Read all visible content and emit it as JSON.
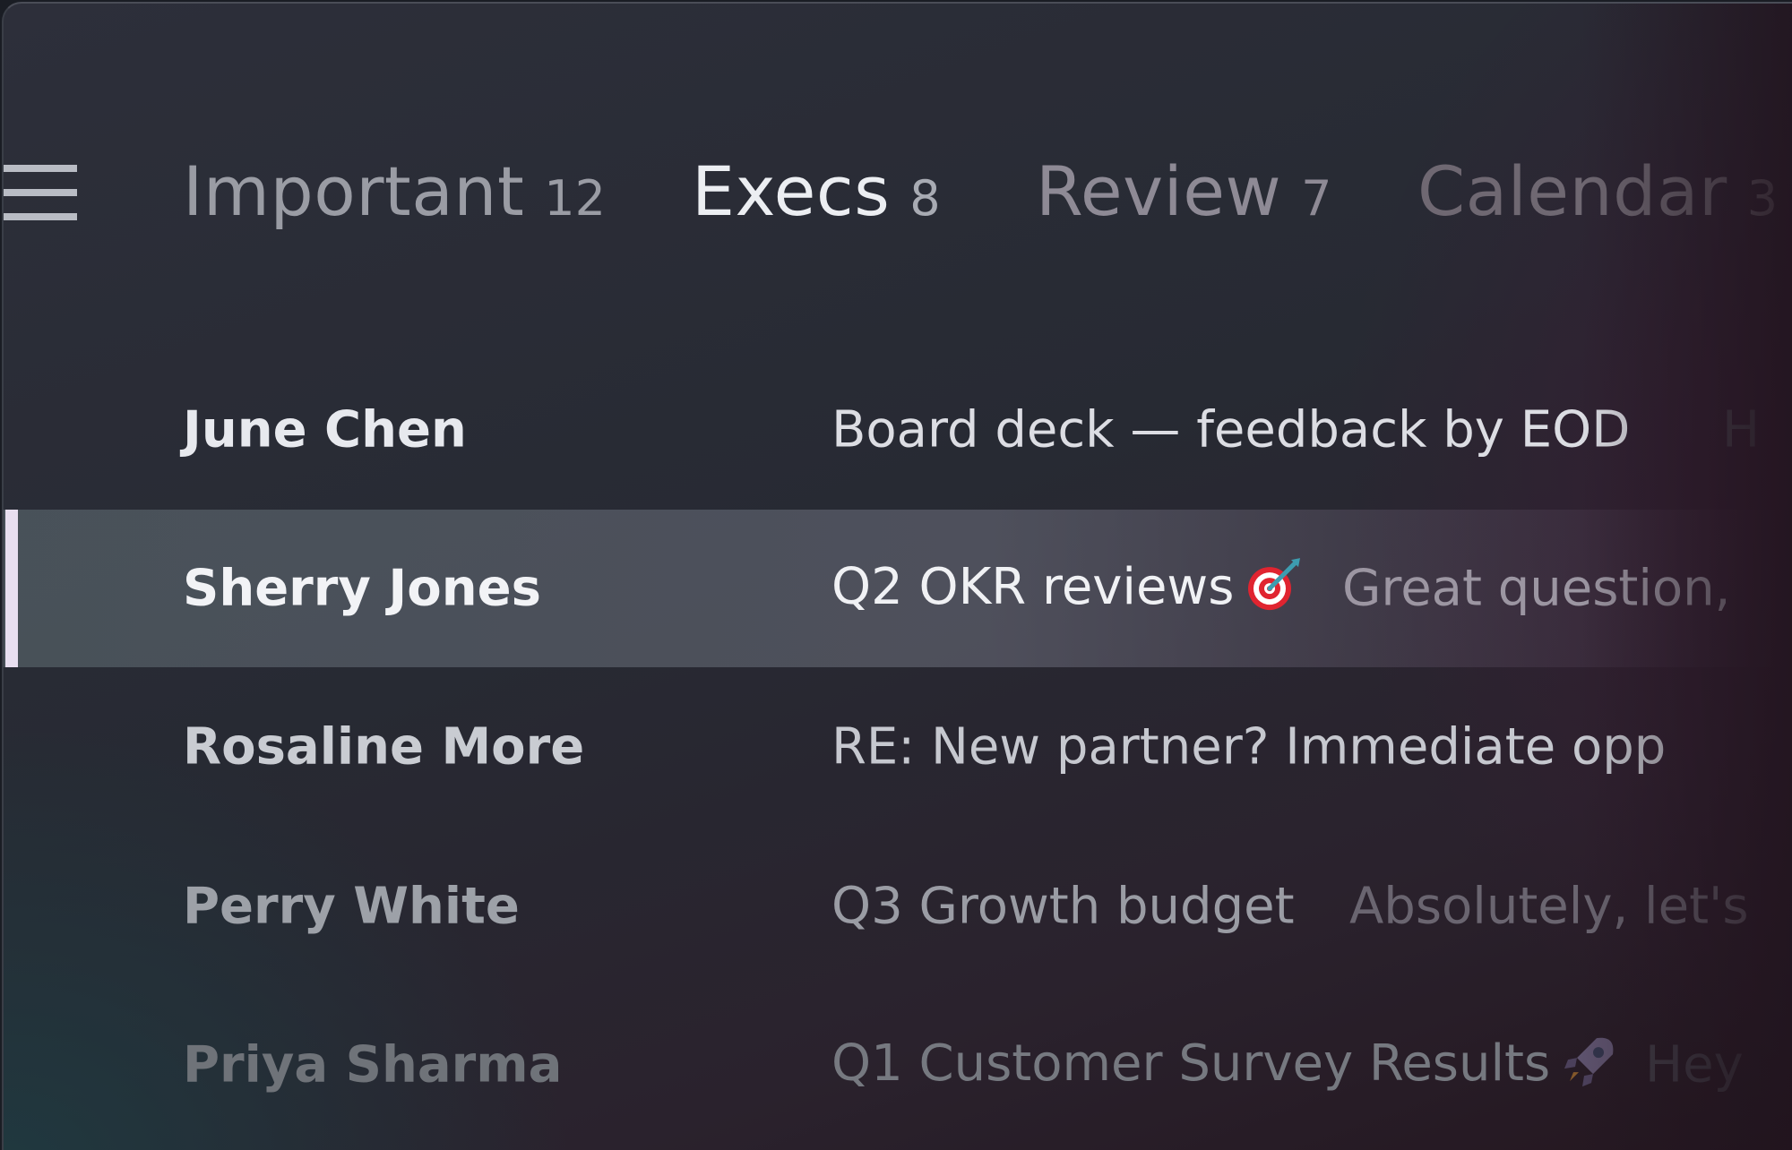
{
  "tabs": [
    {
      "label": "Important",
      "count": "12"
    },
    {
      "label": "Execs",
      "count": "8"
    },
    {
      "label": "Review",
      "count": "7"
    },
    {
      "label": "Calendar",
      "count": "3"
    }
  ],
  "selected_tab": "Execs",
  "messages": [
    {
      "sender": "June Chen",
      "subject": "Board deck — feedback by EOD",
      "snippet": "H"
    },
    {
      "sender": "Sherry Jones",
      "subject": "Q2 OKR reviews",
      "subject_icon": "target-icon",
      "snippet": "Great question,",
      "selected": true
    },
    {
      "sender": "Rosaline More",
      "subject": "RE: New partner? Immediate opp",
      "snippet": ""
    },
    {
      "sender": "Perry White",
      "subject": "Q3 Growth budget",
      "snippet": "Absolutely, let's"
    },
    {
      "sender": "Priya Sharma",
      "subject": "Q1 Customer Survey Results",
      "subject_icon": "rocket-icon",
      "snippet": "Hey"
    }
  ],
  "colors": {
    "selection_bar": "#e8dff0",
    "active_tab": "#eceef2"
  }
}
